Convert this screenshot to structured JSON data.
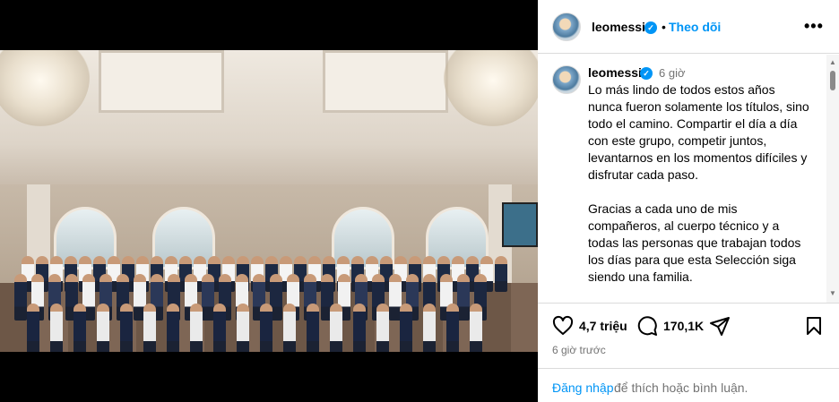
{
  "header": {
    "username": "leomessi",
    "verified_icon": "verified-badge-icon",
    "separator": "•",
    "follow_label": "Theo dõi",
    "more_icon": "more-options-icon",
    "more_label": "•••"
  },
  "post": {
    "username": "leomessi",
    "time_ago": "6 giờ",
    "caption": "Lo más lindo de todos estos años nunca fueron solamente los títulos, sino todo el camino. Compartir el día a día con este grupo, competir juntos, levantarnos en los momentos difíciles y disfrutar cada paso.\n\nGracias a cada uno de mis compañeros, al cuerpo técnico y a todas las personas que trabajan todos los días para que esta Selección siga siendo una familia.\n\nPase lo que pase mañana, este grupo ya escribió una historia que nunca vamos a"
  },
  "actions": {
    "like_icon": "heart-icon",
    "likes": "4,7 triệu",
    "comment_icon": "comment-icon",
    "comments": "170,1K",
    "share_icon": "share-icon",
    "save_icon": "bookmark-icon",
    "posted": "6 giờ trước"
  },
  "login": {
    "link": "Đăng nhập",
    "rest": "để thích hoặc bình luận."
  },
  "colors": {
    "accent": "#0095f6",
    "secondary_text": "#737373",
    "border": "#dbdbdb"
  }
}
